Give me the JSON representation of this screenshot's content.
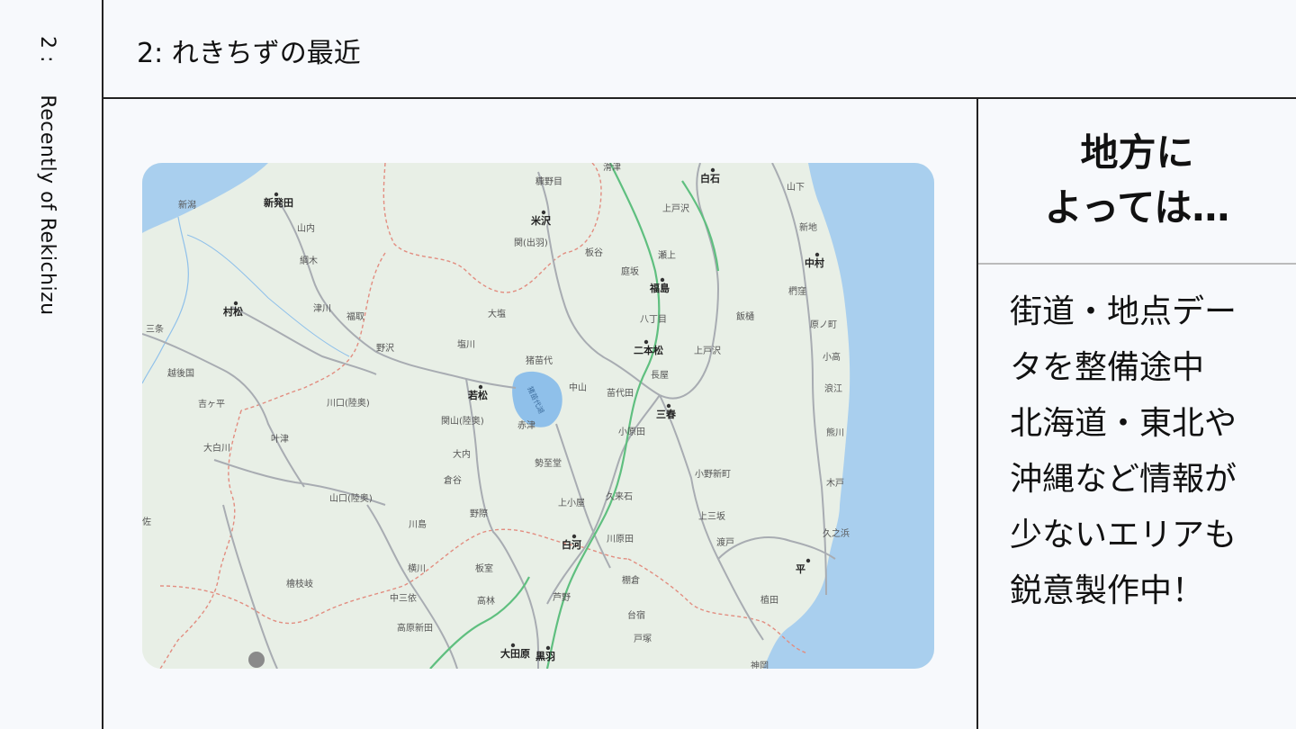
{
  "sidebar": {
    "number": "2 :",
    "label": "Recently of Rekichizu"
  },
  "header": {
    "title": "2: れきちずの最近"
  },
  "map": {
    "labels": [
      {
        "text": "新潟",
        "bold": false
      },
      {
        "text": "新発田",
        "bold": true
      },
      {
        "text": "山内",
        "bold": false
      },
      {
        "text": "綱木",
        "bold": false
      },
      {
        "text": "村松",
        "bold": true
      },
      {
        "text": "津川",
        "bold": false
      },
      {
        "text": "福取",
        "bold": false
      },
      {
        "text": "三条",
        "bold": false
      },
      {
        "text": "越後国",
        "bold": false
      },
      {
        "text": "吉ヶ平",
        "bold": false
      },
      {
        "text": "大白川",
        "bold": false
      },
      {
        "text": "叶津",
        "bold": false
      },
      {
        "text": "川口(陸奥)",
        "bold": false
      },
      {
        "text": "野沢",
        "bold": false
      },
      {
        "text": "大塩",
        "bold": false
      },
      {
        "text": "塩川",
        "bold": false
      },
      {
        "text": "若松",
        "bold": true
      },
      {
        "text": "関山(陸奥)",
        "bold": false
      },
      {
        "text": "大内",
        "bold": false
      },
      {
        "text": "倉谷",
        "bold": false
      },
      {
        "text": "野際",
        "bold": false
      },
      {
        "text": "川島",
        "bold": false
      },
      {
        "text": "山口(陸奥)",
        "bold": false
      },
      {
        "text": "横川",
        "bold": false
      },
      {
        "text": "板室",
        "bold": false
      },
      {
        "text": "檜枝岐",
        "bold": false
      },
      {
        "text": "中三依",
        "bold": false
      },
      {
        "text": "高林",
        "bold": false
      },
      {
        "text": "高原新田",
        "bold": false
      },
      {
        "text": "大田原",
        "bold": true
      },
      {
        "text": "黒羽",
        "bold": true
      },
      {
        "text": "米沢",
        "bold": true
      },
      {
        "text": "糠野目",
        "bold": false
      },
      {
        "text": "関(出羽)",
        "bold": false
      },
      {
        "text": "板谷",
        "bold": false
      },
      {
        "text": "庭坂",
        "bold": false
      },
      {
        "text": "猪苗代",
        "bold": false
      },
      {
        "text": "中山",
        "bold": false
      },
      {
        "text": "赤津",
        "bold": false
      },
      {
        "text": "勢至堂",
        "bold": false
      },
      {
        "text": "上小屋",
        "bold": false
      },
      {
        "text": "白河",
        "bold": true
      },
      {
        "text": "芦野",
        "bold": false
      },
      {
        "text": "滑津",
        "bold": false
      },
      {
        "text": "白石",
        "bold": true
      },
      {
        "text": "上戸沢",
        "bold": false
      },
      {
        "text": "瀬上",
        "bold": false
      },
      {
        "text": "福島",
        "bold": true
      },
      {
        "text": "八丁目",
        "bold": false
      },
      {
        "text": "二本松",
        "bold": true
      },
      {
        "text": "上戸沢",
        "bold": false
      },
      {
        "text": "長屋",
        "bold": false
      },
      {
        "text": "苗代田",
        "bold": false
      },
      {
        "text": "三春",
        "bold": true
      },
      {
        "text": "小原田",
        "bold": false
      },
      {
        "text": "久来石",
        "bold": false
      },
      {
        "text": "川原田",
        "bold": false
      },
      {
        "text": "棚倉",
        "bold": false
      },
      {
        "text": "台宿",
        "bold": false
      },
      {
        "text": "戸塚",
        "bold": false
      },
      {
        "text": "飯樋",
        "bold": false
      },
      {
        "text": "小野新町",
        "bold": false
      },
      {
        "text": "上三坂",
        "bold": false
      },
      {
        "text": "渡戸",
        "bold": false
      },
      {
        "text": "山下",
        "bold": false
      },
      {
        "text": "新地",
        "bold": false
      },
      {
        "text": "中村",
        "bold": true
      },
      {
        "text": "椚窪",
        "bold": false
      },
      {
        "text": "原ノ町",
        "bold": false
      },
      {
        "text": "小高",
        "bold": false
      },
      {
        "text": "浪江",
        "bold": false
      },
      {
        "text": "熊川",
        "bold": false
      },
      {
        "text": "木戸",
        "bold": false
      },
      {
        "text": "久之浜",
        "bold": false
      },
      {
        "text": "平",
        "bold": true
      },
      {
        "text": "植田",
        "bold": false
      },
      {
        "text": "神岡",
        "bold": false
      },
      {
        "text": "猪苗代湖",
        "bold": false
      },
      {
        "text": "佐",
        "bold": false
      }
    ]
  },
  "panel": {
    "heading_lines": [
      "地方に",
      "よっては…"
    ],
    "body_lines": [
      "街道・地点デー",
      "タを整備途中",
      "北海道・東北や",
      "沖縄など情報が",
      "少ないエリアも",
      "鋭意製作中！"
    ]
  },
  "colors": {
    "land": "#e8efe6",
    "sea": "#a9cfee",
    "road": "#a8acb2",
    "border": "#e28d80",
    "rail": "#5fbf7f",
    "river": "#8fc0ea"
  }
}
